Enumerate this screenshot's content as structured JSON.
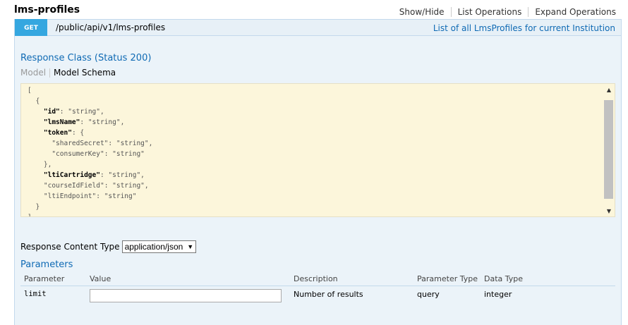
{
  "resource": {
    "title": "lms-profiles",
    "links": [
      "Show/Hide",
      "List Operations",
      "Expand Operations"
    ]
  },
  "operation": {
    "method": "GET",
    "path": "/public/api/v1/lms-profiles",
    "summary": "List of all LmsProfiles for current Institution"
  },
  "response_class": {
    "title": "Response Class (Status 200)",
    "tabs": {
      "model": "Model",
      "schema": "Model Schema"
    },
    "schema_lines": [
      "[",
      "  {",
      "    \"id\": \"string\",",
      "    \"lmsName\": \"string\",",
      "    \"token\": {",
      "      \"sharedSecret\": \"string\",",
      "      \"consumerKey\": \"string\"",
      "    },",
      "    \"ltiCartridge\": \"string\",",
      "    \"courseIdField\": \"string\",",
      "    \"ltiEndpoint\": \"string\"",
      "  }",
      "]"
    ]
  },
  "response_content_type": {
    "label": "Response Content Type",
    "selected": "application/json"
  },
  "parameters": {
    "title": "Parameters",
    "columns": [
      "Parameter",
      "Value",
      "Description",
      "Parameter Type",
      "Data Type"
    ],
    "rows": [
      {
        "name": "limit",
        "value": "",
        "description": "Number of results",
        "param_type": "query",
        "data_type": "integer"
      }
    ]
  },
  "colors": {
    "accent": "#0f6ab4",
    "get_badge": "#35a7e0",
    "schema_bg": "#fcf6db",
    "content_bg": "#ebf3f9"
  }
}
